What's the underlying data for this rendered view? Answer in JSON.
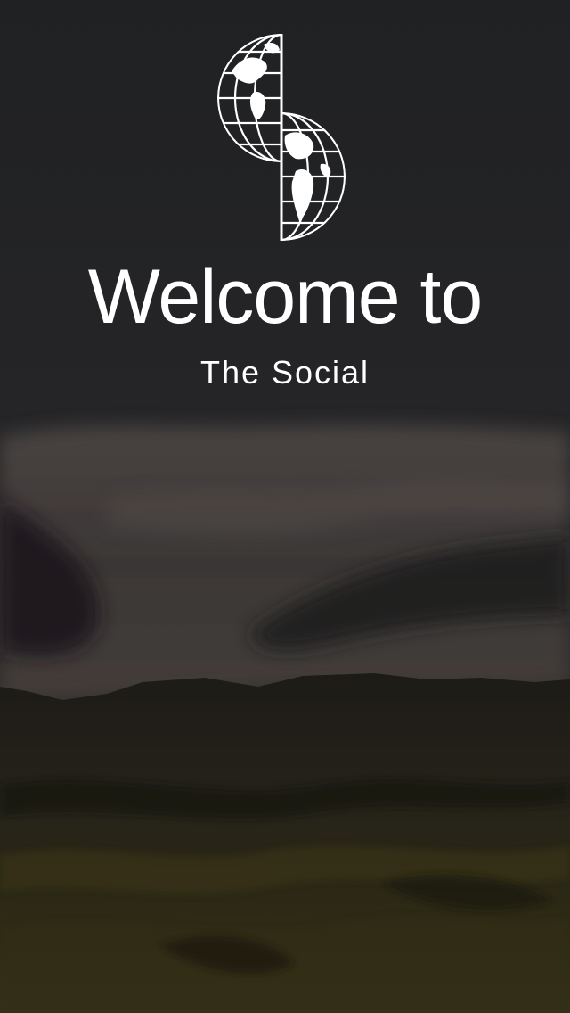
{
  "welcome": {
    "title": "Welcome to",
    "subtitle": "The Social"
  },
  "logo": {
    "icon": "split-globe-logo-icon"
  },
  "background": {
    "scene": "misty-hills-photo"
  },
  "colors": {
    "sky": "#212224",
    "cloud": "#4a4442",
    "cloud_shadow": "#1b1a1c",
    "hill_dark": "#1c1a12",
    "hill_mid": "#2e2a16",
    "text": "#ffffff"
  }
}
